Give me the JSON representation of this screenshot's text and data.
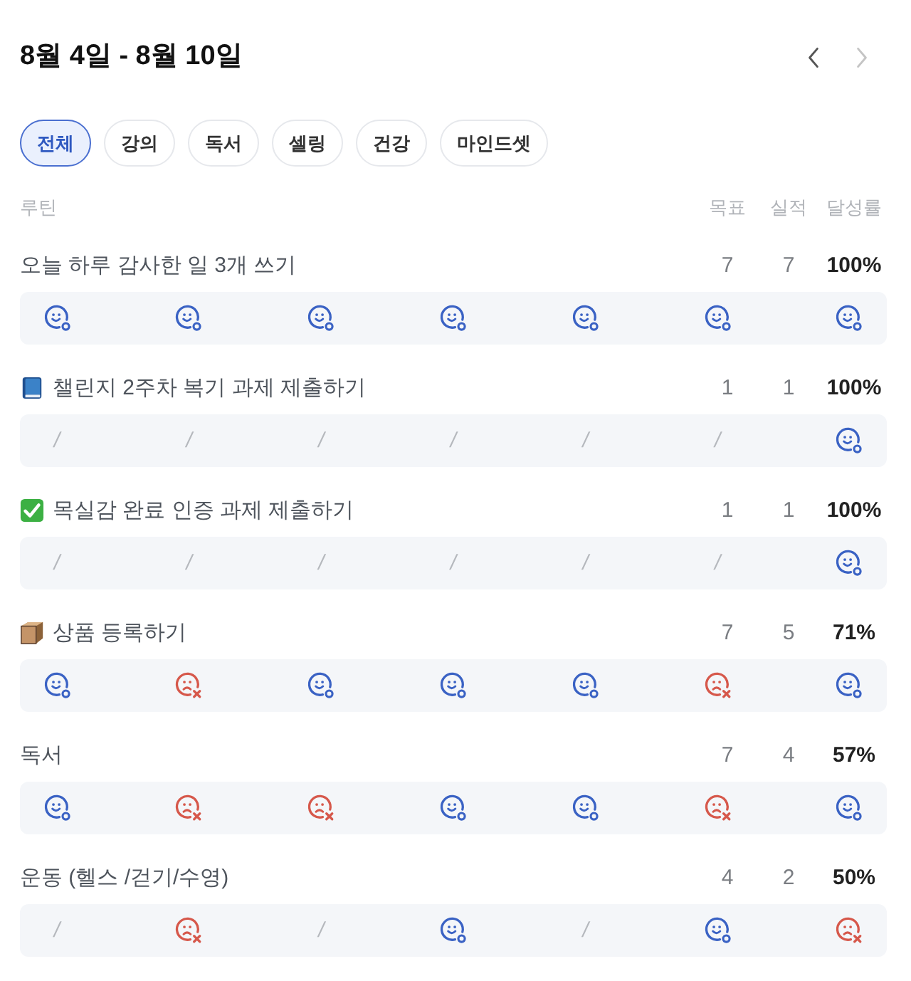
{
  "header": {
    "title": "8월 4일 - 8월 10일",
    "nav": [
      {
        "kind": "prev",
        "disabled": false
      },
      {
        "kind": "next",
        "disabled": true
      }
    ]
  },
  "filters": [
    {
      "label": "전체",
      "selected": true
    },
    {
      "label": "강의",
      "selected": false
    },
    {
      "label": "독서",
      "selected": false
    },
    {
      "label": "셀링",
      "selected": false
    },
    {
      "label": "건강",
      "selected": false
    },
    {
      "label": "마인드셋",
      "selected": false
    }
  ],
  "columns": {
    "routine": "루틴",
    "goal": "목표",
    "actual": "실적",
    "rate": "달성률"
  },
  "routines": [
    {
      "kind": "plain",
      "title": "오늘 하루 감사한 일 3개 쓰기",
      "goal": "7",
      "actual": "7",
      "rate": "100%",
      "days": [
        {
          "kind": "done"
        },
        {
          "kind": "done"
        },
        {
          "kind": "done"
        },
        {
          "kind": "done"
        },
        {
          "kind": "done"
        },
        {
          "kind": "done"
        },
        {
          "kind": "done"
        }
      ]
    },
    {
      "kind": "book",
      "title": "챌린지 2주차 복기 과제 제출하기",
      "goal": "1",
      "actual": "1",
      "rate": "100%",
      "days": [
        {
          "kind": "empty",
          "mark": "/"
        },
        {
          "kind": "empty",
          "mark": "/"
        },
        {
          "kind": "empty",
          "mark": "/"
        },
        {
          "kind": "empty",
          "mark": "/"
        },
        {
          "kind": "empty",
          "mark": "/"
        },
        {
          "kind": "empty",
          "mark": "/"
        },
        {
          "kind": "done"
        }
      ]
    },
    {
      "kind": "check",
      "title": "목실감 완료 인증 과제 제출하기",
      "goal": "1",
      "actual": "1",
      "rate": "100%",
      "days": [
        {
          "kind": "empty",
          "mark": "/"
        },
        {
          "kind": "empty",
          "mark": "/"
        },
        {
          "kind": "empty",
          "mark": "/"
        },
        {
          "kind": "empty",
          "mark": "/"
        },
        {
          "kind": "empty",
          "mark": "/"
        },
        {
          "kind": "empty",
          "mark": "/"
        },
        {
          "kind": "done"
        }
      ]
    },
    {
      "kind": "package",
      "title": "상품 등록하기",
      "goal": "7",
      "actual": "5",
      "rate": "71%",
      "days": [
        {
          "kind": "done"
        },
        {
          "kind": "missed"
        },
        {
          "kind": "done"
        },
        {
          "kind": "done"
        },
        {
          "kind": "done"
        },
        {
          "kind": "missed"
        },
        {
          "kind": "done"
        }
      ]
    },
    {
      "kind": "plain",
      "title": "독서",
      "goal": "7",
      "actual": "4",
      "rate": "57%",
      "days": [
        {
          "kind": "done"
        },
        {
          "kind": "missed"
        },
        {
          "kind": "missed"
        },
        {
          "kind": "done"
        },
        {
          "kind": "done"
        },
        {
          "kind": "missed"
        },
        {
          "kind": "done"
        }
      ]
    },
    {
      "kind": "plain",
      "title": "운동 (헬스 /걷기/수영)",
      "goal": "4",
      "actual": "2",
      "rate": "50%",
      "days": [
        {
          "kind": "empty",
          "mark": "/"
        },
        {
          "kind": "missed"
        },
        {
          "kind": "empty",
          "mark": "/"
        },
        {
          "kind": "done"
        },
        {
          "kind": "empty",
          "mark": "/"
        },
        {
          "kind": "done"
        },
        {
          "kind": "missed"
        }
      ]
    }
  ]
}
